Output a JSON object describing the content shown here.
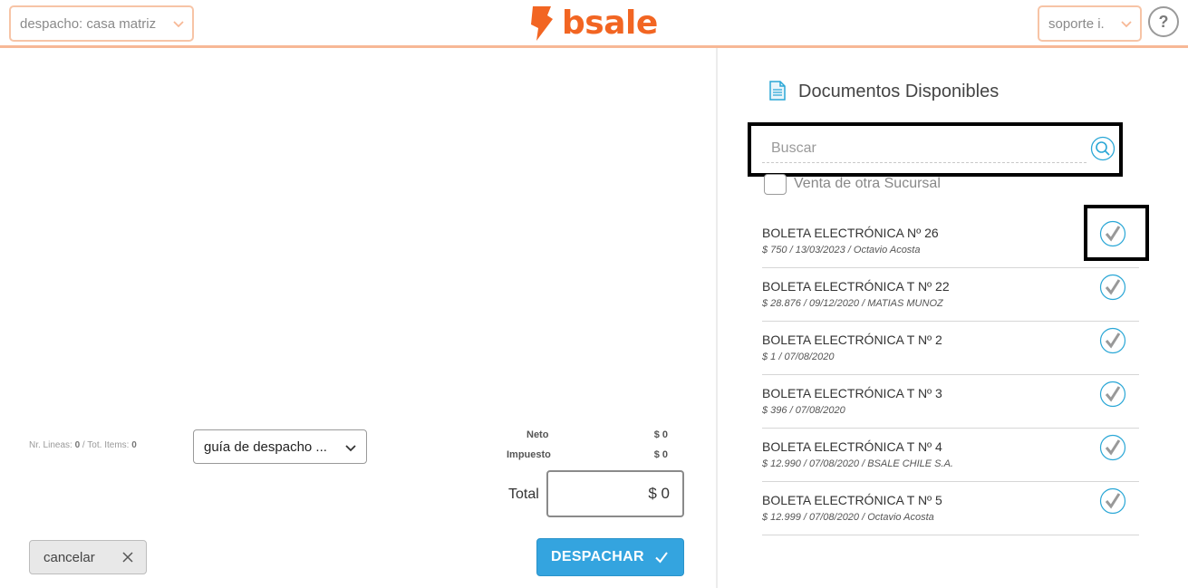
{
  "header": {
    "branch_select": "despacho: casa matriz",
    "logo_text": "bsale",
    "user_select": "soporte i.",
    "help": "?",
    "brand_color": "#f26522",
    "border_color": "#f7b896"
  },
  "footer": {
    "counts_prefix": "Nr. Lineas: ",
    "lines": "0",
    "counts_middle": " / Tot. Items: ",
    "items": "0",
    "doc_type": "guía de despacho ...",
    "neto_label": "Neto",
    "neto_value": "$ 0",
    "impuesto_label": "Impuesto",
    "impuesto_value": "$ 0",
    "total_label": "Total",
    "total_value": "$ 0",
    "cancel_label": "cancelar",
    "dispatch_label": "DESPACHAR",
    "dispatch_color": "#34a4df"
  },
  "panel": {
    "title": "Documentos Disponibles",
    "search_placeholder": "Buscar",
    "other_branch_label": "Venta de otra Sucursal",
    "icon_color": "#2aa7d6",
    "documents": [
      {
        "title": "BOLETA ELECTRÓNICA Nº 26",
        "detail": "$ 750 / 13/03/2023 / Octavio Acosta"
      },
      {
        "title": "BOLETA ELECTRÓNICA T Nº 22",
        "detail": "$ 28.876 / 09/12/2020 / MATIAS MUNOZ"
      },
      {
        "title": "BOLETA ELECTRÓNICA T Nº 2",
        "detail": "$ 1 / 07/08/2020"
      },
      {
        "title": "BOLETA ELECTRÓNICA T Nº 3",
        "detail": "$ 396 / 07/08/2020"
      },
      {
        "title": "BOLETA ELECTRÓNICA T Nº 4",
        "detail": "$ 12.990 / 07/08/2020 / BSALE CHILE S.A."
      },
      {
        "title": "BOLETA ELECTRÓNICA T Nº 5",
        "detail": "$ 12.999 / 07/08/2020 / Octavio Acosta"
      }
    ]
  }
}
